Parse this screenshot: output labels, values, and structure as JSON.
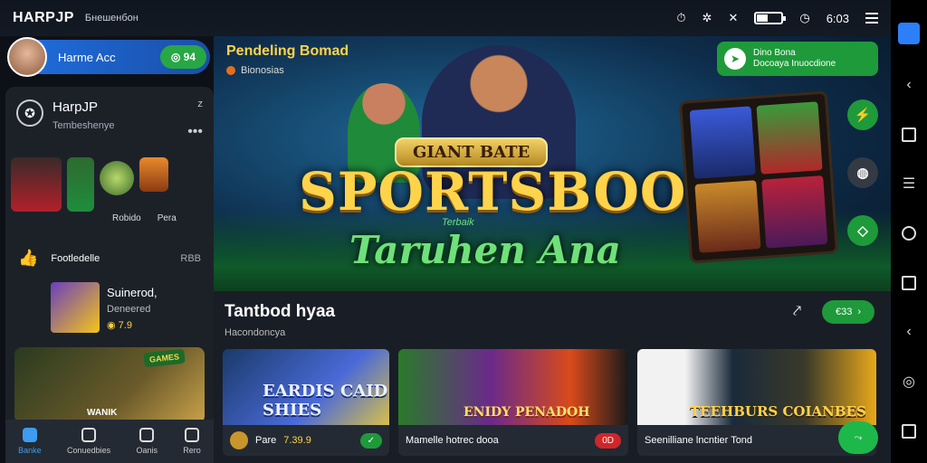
{
  "statusbar": {
    "brand": "HARPJP",
    "subtitle": "Бнешенбон",
    "time": "6:03"
  },
  "profile": {
    "name": "Harme Acc",
    "balance": "94"
  },
  "sidebar": {
    "title": "HarpJP",
    "subtitle": "Tembeshenye",
    "thumb_labels": [
      "Robido",
      "Pera"
    ],
    "section_label": "Footledelle",
    "section_code": "RBB",
    "feature": {
      "title": "Suinerod,",
      "subtitle": "Deneered",
      "odds": "7.9"
    },
    "promo": {
      "tag": "GAMES",
      "label": "WANIK"
    },
    "bottom_nav": [
      {
        "label": "Banke",
        "active": true
      },
      {
        "label": "Conuedbies",
        "active": false
      },
      {
        "label": "Oanis",
        "active": false
      },
      {
        "label": "Rero",
        "active": false
      }
    ]
  },
  "hero": {
    "eyebrow": "Pendeling Bomad",
    "sub": "Bionosias",
    "plate": "GIANT BATE",
    "title": "SPORTSBOOK",
    "small": "Terbaik",
    "subtitle": "Taruhen Ana",
    "notify_line1": "Dino Bona",
    "notify_line2": "Docoaya Inuocdione"
  },
  "section": {
    "title": "Tantbod hyaa",
    "subtitle": "Hacondoncya",
    "pill": "€33",
    "cards": [
      {
        "art_text": "EARDIS CAID SHIES",
        "label": "Pare",
        "odds": "7.39.9",
        "pill": "✓"
      },
      {
        "art_text": "ENIDY PENADOH",
        "label": "Mamelle hotrec dooa",
        "odds": "",
        "pill": "0D"
      },
      {
        "art_text": "TEEHBURS COIANBES",
        "label": "Seenilliane lncntier Tond",
        "odds": "",
        "pill": ""
      }
    ]
  },
  "colors": {
    "accent": "#1e9a3a",
    "brand_blue": "#1f6fe0",
    "gold": "#ffd34a"
  }
}
